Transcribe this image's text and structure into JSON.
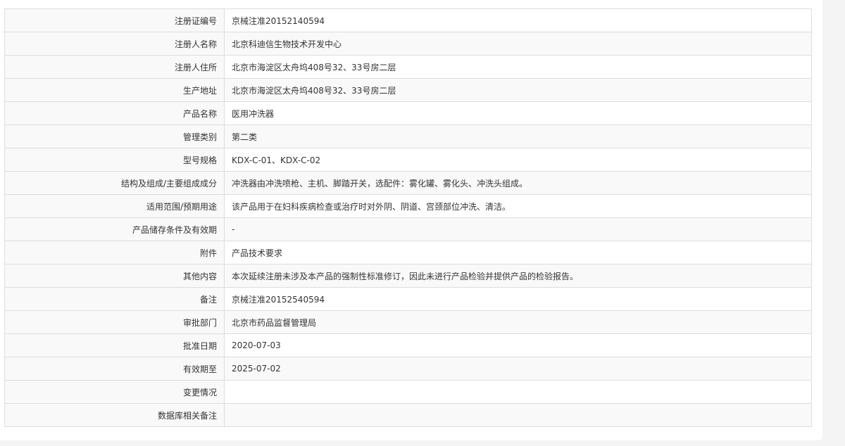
{
  "record": {
    "rows": [
      {
        "label": "注册证编号",
        "value": "京械注准20152140594"
      },
      {
        "label": "注册人名称",
        "value": "北京科迪信生物技术开发中心"
      },
      {
        "label": "注册人住所",
        "value": "北京市海淀区太舟坞408号32、33号房二层"
      },
      {
        "label": "生产地址",
        "value": "北京市海淀区太舟坞408号32、33号房二层"
      },
      {
        "label": "产品名称",
        "value": "医用冲洗器"
      },
      {
        "label": "管理类别",
        "value": "第二类"
      },
      {
        "label": "型号规格",
        "value": "KDX-C-01、KDX-C-02"
      },
      {
        "label": "结构及组成/主要组成成分",
        "value": "冲洗器由冲洗喷枪、主机、脚踏开关，选配件：雾化罐、雾化头、冲洗头组成。"
      },
      {
        "label": "适用范围/预期用途",
        "value": "该产品用于在妇科疾病检查或治疗时对外阴、阴道、宫颈部位冲洗、清洁。"
      },
      {
        "label": "产品储存条件及有效期",
        "value": "-"
      },
      {
        "label": "附件",
        "value": "产品技术要求"
      },
      {
        "label": "其他内容",
        "value": "本次延续注册未涉及本产品的强制性标准修订，因此未进行产品检验并提供产品的检验报告。"
      },
      {
        "label": "备注",
        "value": "京械注准20152540594"
      },
      {
        "label": "审批部门",
        "value": "北京市药品监督管理局"
      },
      {
        "label": "批准日期",
        "value": "2020-07-03"
      },
      {
        "label": "有效期至",
        "value": "2025-07-02"
      },
      {
        "label": "变更情况",
        "value": ""
      },
      {
        "label": "数据库相关备注",
        "value": ""
      }
    ]
  }
}
